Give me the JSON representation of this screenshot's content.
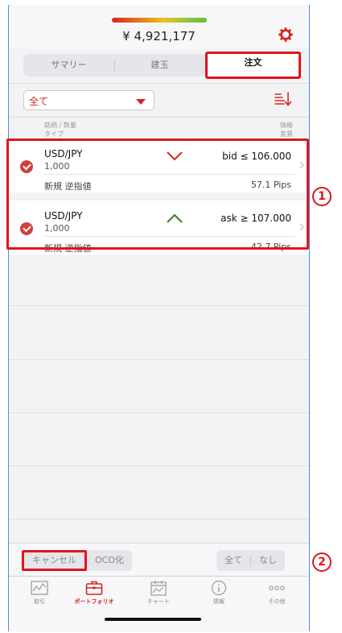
{
  "header": {
    "balance": "¥ 4,921,177"
  },
  "segments": [
    {
      "label": "サマリー"
    },
    {
      "label": "建玉"
    },
    {
      "label": "注文"
    }
  ],
  "filter": {
    "selected": "全て"
  },
  "columns": {
    "left_line1": "銘柄 / 数量",
    "left_line2": "タイプ",
    "right_line1": "価格",
    "right_line2": "差異"
  },
  "orders": [
    {
      "pair": "USD/JPY",
      "quantity": "1,000",
      "direction": "down",
      "condition": "bid ≤ 106.000",
      "order_type": "新規 逆指値",
      "diff": "57.1 Pips"
    },
    {
      "pair": "USD/JPY",
      "quantity": "1,000",
      "direction": "up",
      "condition": "ask ≥ 107.000",
      "order_type": "新規 逆指値",
      "diff": "42.7 Pips"
    }
  ],
  "annotations": [
    "1",
    "2"
  ],
  "actions": {
    "cancel": "キャンセル",
    "oco": "OCO化",
    "all": "全て",
    "none": "なし"
  },
  "tabs": [
    {
      "label": "取引",
      "icon": "trade-chart-icon"
    },
    {
      "label": "ポートフォリオ",
      "icon": "briefcase-icon"
    },
    {
      "label": "チャート",
      "icon": "calendar-chart-icon"
    },
    {
      "label": "情報",
      "icon": "info-icon"
    },
    {
      "label": "その他",
      "icon": "more-dots-icon"
    }
  ],
  "colors": {
    "accent": "#d7261e",
    "highlight": "#e0141e",
    "up_arrow": "#3d7a2a"
  }
}
